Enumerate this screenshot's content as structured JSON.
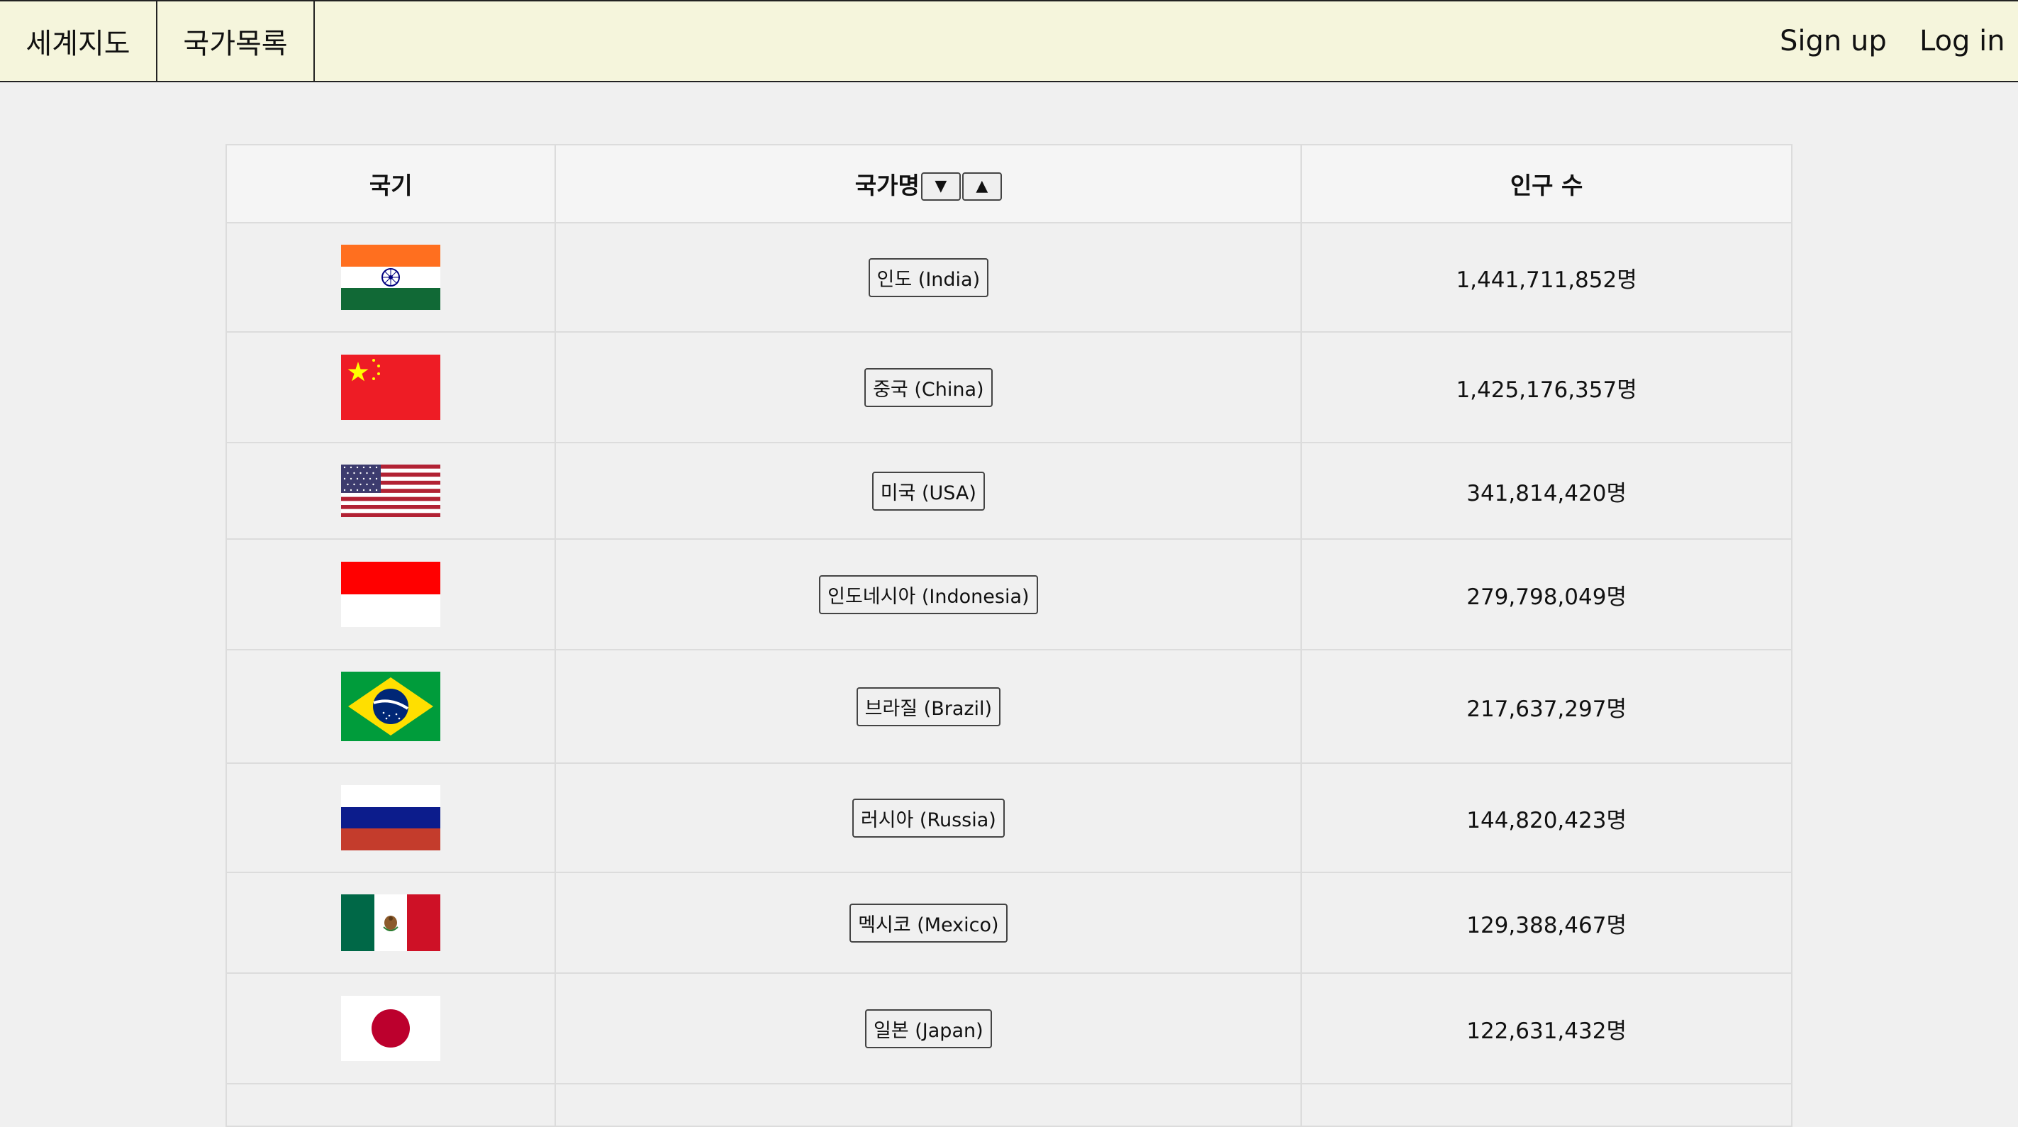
{
  "nav": {
    "world_map": "세계지도",
    "country_list": "국가목록",
    "sign_up": "Sign up",
    "log_in": "Log in"
  },
  "table": {
    "headers": {
      "flag": "국기",
      "name": "국가명",
      "population": "인구 수"
    },
    "sort_desc": "▼",
    "sort_asc": "▲",
    "rows": [
      {
        "name": "인도 (India)",
        "population": "1,441,711,852명",
        "flag": "india"
      },
      {
        "name": "중국 (China)",
        "population": "1,425,176,357명",
        "flag": "china"
      },
      {
        "name": "미국 (USA)",
        "population": "341,814,420명",
        "flag": "usa"
      },
      {
        "name": "인도네시아 (Indonesia)",
        "population": "279,798,049명",
        "flag": "indonesia"
      },
      {
        "name": "브라질 (Brazil)",
        "population": "217,637,297명",
        "flag": "brazil"
      },
      {
        "name": "러시아 (Russia)",
        "population": "144,820,423명",
        "flag": "russia"
      },
      {
        "name": "멕시코 (Mexico)",
        "population": "129,388,467명",
        "flag": "mexico"
      },
      {
        "name": "일본 (Japan)",
        "population": "122,631,432명",
        "flag": "japan"
      }
    ]
  }
}
